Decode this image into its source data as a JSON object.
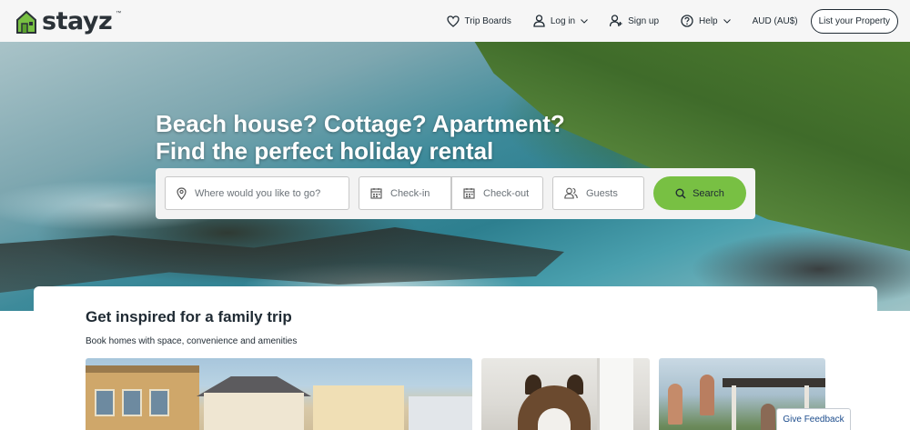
{
  "brand": {
    "name": "stayz",
    "trademark": "™",
    "accent": "#78c043"
  },
  "nav": {
    "trip_boards": "Trip Boards",
    "log_in": "Log in",
    "sign_up": "Sign up",
    "help": "Help",
    "currency": "AUD (AU$)",
    "list_property": "List your Property"
  },
  "hero": {
    "title_line1": "Beach house? Cottage? Apartment?",
    "title_line2": "Find the perfect holiday rental"
  },
  "search": {
    "where_placeholder": "Where would you like to go?",
    "checkin_placeholder": "Check-in",
    "checkout_placeholder": "Check-out",
    "guests_placeholder": "Guests",
    "button_label": "Search"
  },
  "inspire": {
    "title": "Get inspired for a family trip",
    "subtitle": "Book homes with space, convenience and amenities"
  },
  "feedback": {
    "label": "Give Feedback"
  },
  "icons": {
    "logo": "house-logo-icon",
    "trip_boards": "heart-icon",
    "log_in": "user-icon",
    "sign_up": "user-plus-icon",
    "help": "question-circle-icon",
    "dropdown": "chevron-down-icon",
    "where": "map-pin-icon",
    "calendar": "calendar-icon",
    "guests": "users-icon",
    "search": "search-icon"
  }
}
